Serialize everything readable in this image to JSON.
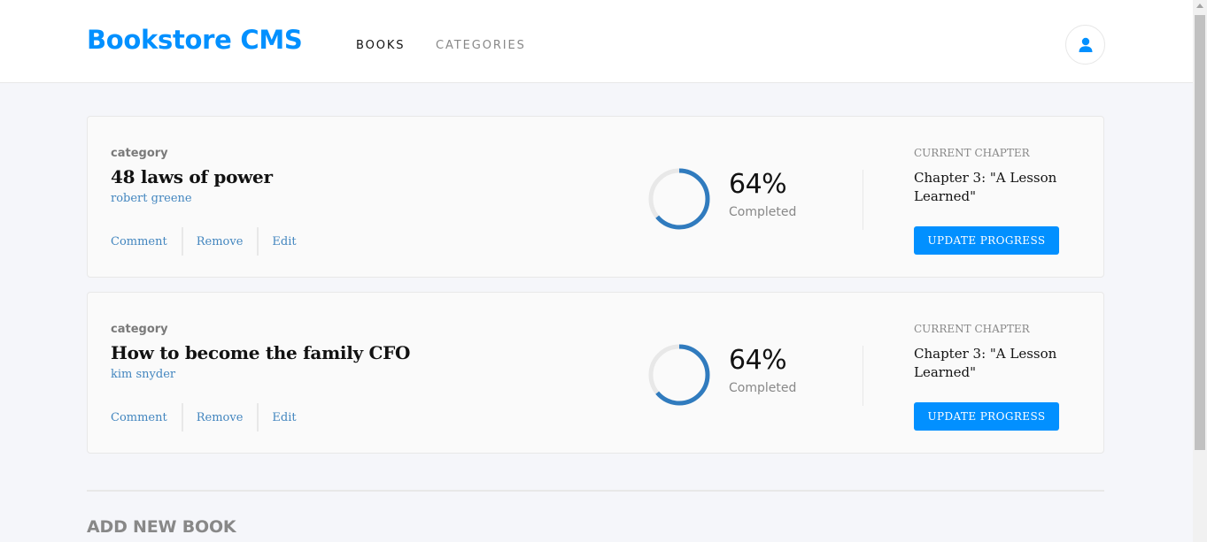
{
  "header": {
    "logo": "Bookstore CMS",
    "nav": {
      "books": "BOOKS",
      "categories": "CATEGORIES"
    },
    "avatar_icon": "user-icon"
  },
  "books": [
    {
      "category": "category",
      "title": "48 laws of power",
      "author": "robert greene",
      "actions": {
        "comment": "Comment",
        "remove": "Remove",
        "edit": "Edit"
      },
      "progress_value": 0.64,
      "percent": "64%",
      "completed_label": "Completed",
      "current_chapter_label": "CURRENT CHAPTER",
      "current_chapter": "Chapter 3: \"A Lesson Learned\"",
      "update_button": "UPDATE PROGRESS"
    },
    {
      "category": "category",
      "title": "How to become the family CFO",
      "author": "kim snyder",
      "actions": {
        "comment": "Comment",
        "remove": "Remove",
        "edit": "Edit"
      },
      "progress_value": 0.64,
      "percent": "64%",
      "completed_label": "Completed",
      "current_chapter_label": "CURRENT CHAPTER",
      "current_chapter": "Chapter 3: \"A Lesson Learned\"",
      "update_button": "UPDATE PROGRESS"
    }
  ],
  "add_book": {
    "title": "ADD NEW BOOK"
  },
  "colors": {
    "accent": "#0290ff",
    "progress": "#307bbe",
    "track": "#e8e8e8",
    "link": "#4386bf"
  }
}
